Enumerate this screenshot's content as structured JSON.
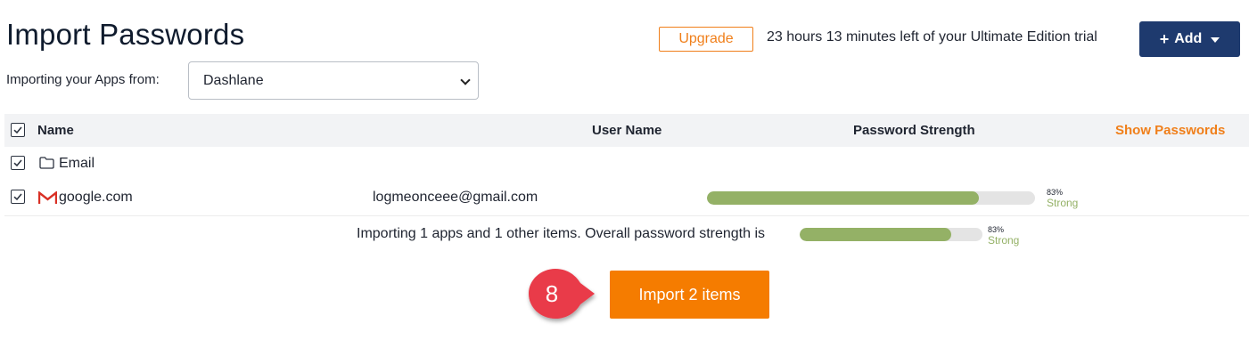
{
  "header": {
    "title": "Import Passwords",
    "upgrade_label": "Upgrade",
    "trial_text": "23 hours 13 minutes left of your Ultimate Edition trial",
    "add_label": "Add"
  },
  "source": {
    "label": "Importing your Apps from:",
    "selected": "Dashlane"
  },
  "table": {
    "columns": {
      "name": "Name",
      "username": "User Name",
      "strength": "Password Strength",
      "show_passwords": "Show Passwords"
    },
    "folder": {
      "label": "Email",
      "icon": "folder-icon",
      "checked": true
    },
    "rows": [
      {
        "site": "google.com",
        "icon": "gmail-icon",
        "username": "logmeonceee@gmail.com",
        "strength_pct": 83,
        "strength_pct_label": "83%",
        "strength_label": "Strong",
        "checked": true
      }
    ]
  },
  "summary": {
    "text": "Importing 1 apps and 1 other items. Overall password strength is",
    "strength_pct": 83,
    "strength_pct_label": "83%",
    "strength_label": "Strong"
  },
  "actions": {
    "import_label": "Import 2 items",
    "step_number": "8"
  },
  "colors": {
    "accent_orange": "#f57c00",
    "navy": "#1e3a6e",
    "strength_green": "#94b166"
  }
}
